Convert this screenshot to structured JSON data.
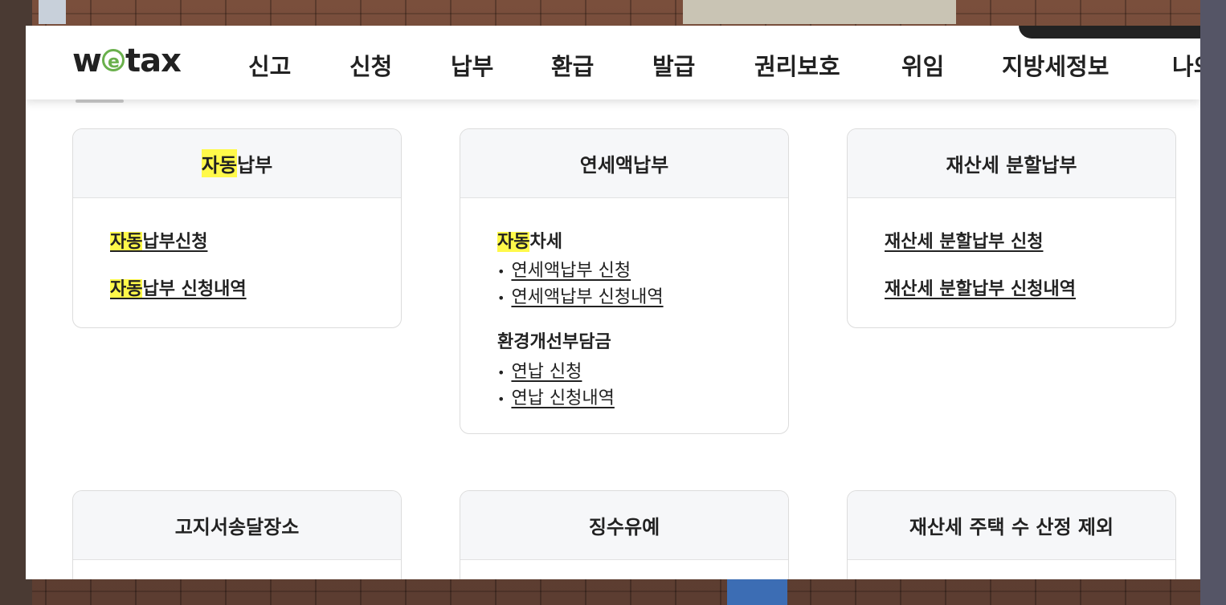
{
  "logo": {
    "pre": "w",
    "e": "e",
    "post": "tax"
  },
  "nav": [
    "신고",
    "신청",
    "납부",
    "환급",
    "발급",
    "권리보호",
    "위임",
    "지방세정보",
    "나의"
  ],
  "highlight_term": "자동",
  "cards_row1": [
    {
      "title_hl": "자동",
      "title_rest": "납부",
      "links": [
        {
          "hl": "자동",
          "rest": "납부신청"
        },
        {
          "hl": "자동",
          "rest": "납부 신청내역"
        }
      ]
    },
    {
      "title": "연세액납부",
      "sections": [
        {
          "hl": "자동",
          "rest": "차세",
          "items": [
            "연세액납부 신청",
            "연세액납부 신청내역"
          ]
        },
        {
          "hl": "",
          "rest": "환경개선부담금",
          "items": [
            "연납 신청",
            "연납 신청내역"
          ]
        }
      ]
    },
    {
      "title": "재산세 분할납부",
      "links": [
        {
          "hl": "",
          "rest": "재산세 분할납부 신청"
        },
        {
          "hl": "",
          "rest": "재산세 분할납부 신청내역"
        }
      ]
    }
  ],
  "cards_row2": [
    {
      "title": "고지서송달장소"
    },
    {
      "title": "징수유예"
    },
    {
      "title": "재산세 주택 수 산정 제외"
    }
  ],
  "colors": {
    "highlight": "#fff94a",
    "logo_accent": "#6ab04c",
    "card_header_bg": "#f6f7f9"
  }
}
